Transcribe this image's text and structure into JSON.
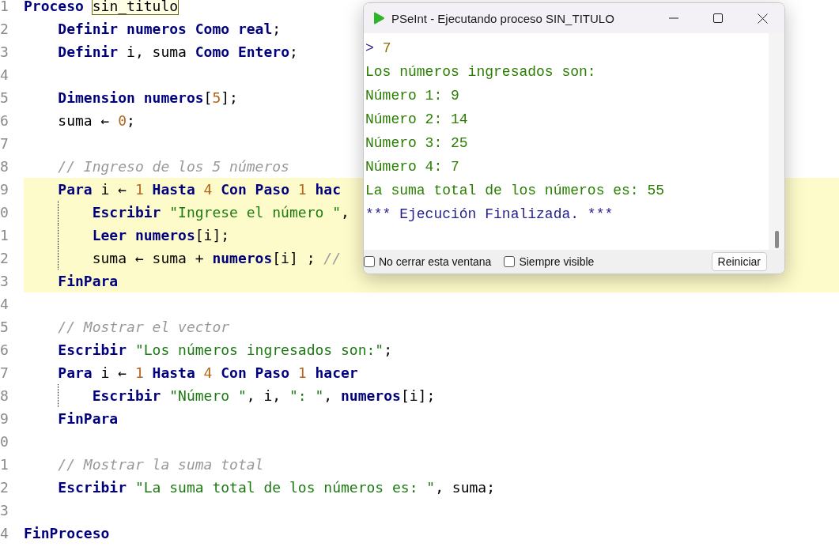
{
  "editor": {
    "lines": [
      {
        "number": "1",
        "highlighted": false,
        "guide": false,
        "tokens": [
          {
            "kind": "keyword",
            "text": "Proceso "
          },
          {
            "kind": "boxed",
            "text": "sin_titulo"
          }
        ]
      },
      {
        "number": "2",
        "highlighted": false,
        "guide": false,
        "tokens": [
          {
            "kind": "keyword",
            "text": "    Definir numeros Como real"
          },
          {
            "kind": "plain",
            "text": ";"
          }
        ]
      },
      {
        "number": "3",
        "highlighted": false,
        "guide": false,
        "tokens": [
          {
            "kind": "keyword",
            "text": "    Definir"
          },
          {
            "kind": "plain",
            "text": " i, suma "
          },
          {
            "kind": "keyword",
            "text": "Como Entero"
          },
          {
            "kind": "plain",
            "text": ";"
          }
        ]
      },
      {
        "number": "4",
        "highlighted": false,
        "guide": false
      },
      {
        "number": "5",
        "highlighted": false,
        "guide": false,
        "tokens": [
          {
            "kind": "keyword",
            "text": "    Dimension numeros"
          },
          {
            "kind": "plain",
            "text": "["
          },
          {
            "kind": "number",
            "text": "5"
          },
          {
            "kind": "plain",
            "text": "];"
          }
        ]
      },
      {
        "number": "6",
        "highlighted": false,
        "guide": false,
        "tokens": [
          {
            "kind": "plain",
            "text": "    suma ← "
          },
          {
            "kind": "number",
            "text": "0"
          },
          {
            "kind": "plain",
            "text": ";"
          }
        ]
      },
      {
        "number": "7",
        "highlighted": false,
        "guide": false
      },
      {
        "number": "8",
        "highlighted": false,
        "guide": false,
        "tokens": [
          {
            "kind": "comment",
            "text": "    // Ingreso de los 5 números"
          }
        ]
      },
      {
        "number": "9",
        "highlighted": true,
        "guide": false,
        "tokens": [
          {
            "kind": "keyword",
            "text": "    Para"
          },
          {
            "kind": "plain",
            "text": " i ← "
          },
          {
            "kind": "number",
            "text": "1"
          },
          {
            "kind": "keyword",
            "text": " Hasta "
          },
          {
            "kind": "number",
            "text": "4"
          },
          {
            "kind": "keyword",
            "text": " Con Paso "
          },
          {
            "kind": "number",
            "text": "1"
          },
          {
            "kind": "keyword",
            "text": " hac"
          }
        ]
      },
      {
        "number": "0",
        "highlighted": true,
        "guide": true,
        "tokens": [
          {
            "kind": "keyword",
            "text": "        Escribir "
          },
          {
            "kind": "string",
            "text": "\"Ingrese el número \""
          },
          {
            "kind": "plain",
            "text": ","
          }
        ]
      },
      {
        "number": "1",
        "highlighted": true,
        "guide": true,
        "tokens": [
          {
            "kind": "keyword",
            "text": "        Leer numeros"
          },
          {
            "kind": "plain",
            "text": "[i];"
          }
        ]
      },
      {
        "number": "2",
        "highlighted": true,
        "guide": true,
        "tokens": [
          {
            "kind": "plain",
            "text": "        suma ← suma + "
          },
          {
            "kind": "keyword",
            "text": "numeros"
          },
          {
            "kind": "plain",
            "text": "[i] ; "
          },
          {
            "kind": "comment",
            "text": "//"
          }
        ]
      },
      {
        "number": "3",
        "highlighted": true,
        "guide": false,
        "tokens": [
          {
            "kind": "keyword",
            "text": "    FinPara"
          }
        ]
      },
      {
        "number": "4",
        "highlighted": false,
        "guide": false
      },
      {
        "number": "5",
        "highlighted": false,
        "guide": false,
        "tokens": [
          {
            "kind": "comment",
            "text": "    // Mostrar el vector"
          }
        ]
      },
      {
        "number": "6",
        "highlighted": false,
        "guide": false,
        "tokens": [
          {
            "kind": "keyword",
            "text": "    Escribir "
          },
          {
            "kind": "string",
            "text": "\"Los números ingresados son:\""
          },
          {
            "kind": "plain",
            "text": ";"
          }
        ]
      },
      {
        "number": "7",
        "highlighted": false,
        "guide": false,
        "tokens": [
          {
            "kind": "keyword",
            "text": "    Para"
          },
          {
            "kind": "plain",
            "text": " i ← "
          },
          {
            "kind": "number",
            "text": "1"
          },
          {
            "kind": "keyword",
            "text": " Hasta "
          },
          {
            "kind": "number",
            "text": "4"
          },
          {
            "kind": "keyword",
            "text": " Con Paso "
          },
          {
            "kind": "number",
            "text": "1"
          },
          {
            "kind": "keyword",
            "text": " hacer"
          }
        ]
      },
      {
        "number": "8",
        "highlighted": false,
        "guide": true,
        "tokens": [
          {
            "kind": "keyword",
            "text": "        Escribir "
          },
          {
            "kind": "string",
            "text": "\"Número \""
          },
          {
            "kind": "plain",
            "text": ", i, "
          },
          {
            "kind": "string",
            "text": "\": \""
          },
          {
            "kind": "plain",
            "text": ", "
          },
          {
            "kind": "keyword",
            "text": "numeros"
          },
          {
            "kind": "plain",
            "text": "[i];"
          }
        ]
      },
      {
        "number": "9",
        "highlighted": false,
        "guide": false,
        "tokens": [
          {
            "kind": "keyword",
            "text": "    FinPara"
          }
        ]
      },
      {
        "number": "0",
        "highlighted": false,
        "guide": false
      },
      {
        "number": "1",
        "highlighted": false,
        "guide": false,
        "tokens": [
          {
            "kind": "comment",
            "text": "    // Mostrar la suma total"
          }
        ]
      },
      {
        "number": "2",
        "highlighted": false,
        "guide": false,
        "tokens": [
          {
            "kind": "keyword",
            "text": "    Escribir "
          },
          {
            "kind": "string",
            "text": "\"La suma total de los números es: \""
          },
          {
            "kind": "plain",
            "text": ", suma;"
          }
        ]
      },
      {
        "number": "3",
        "highlighted": false,
        "guide": false
      },
      {
        "number": "4",
        "highlighted": false,
        "guide": false,
        "tokens": [
          {
            "kind": "keyword",
            "text": "FinProceso"
          }
        ]
      }
    ]
  },
  "run_window": {
    "title": "PSeInt - Ejecutando proceso SIN_TITULO",
    "console": [
      {
        "kind": "input",
        "prompt": ">",
        "text": "7"
      },
      {
        "kind": "output",
        "text": "Los números ingresados son:"
      },
      {
        "kind": "output",
        "text": "Número 1: 9"
      },
      {
        "kind": "output",
        "text": "Número 2: 14"
      },
      {
        "kind": "output",
        "text": "Número 3: 25"
      },
      {
        "kind": "output",
        "text": "Número 4: 7"
      },
      {
        "kind": "output",
        "text": "La suma total de los números es: 55"
      },
      {
        "kind": "status",
        "text": "*** Ejecución Finalizada. ***"
      }
    ],
    "options": [
      {
        "label": "No cerrar esta ventana",
        "checked": false
      },
      {
        "label": "Siempre visible",
        "checked": false
      }
    ],
    "button": "Reiniciar"
  }
}
